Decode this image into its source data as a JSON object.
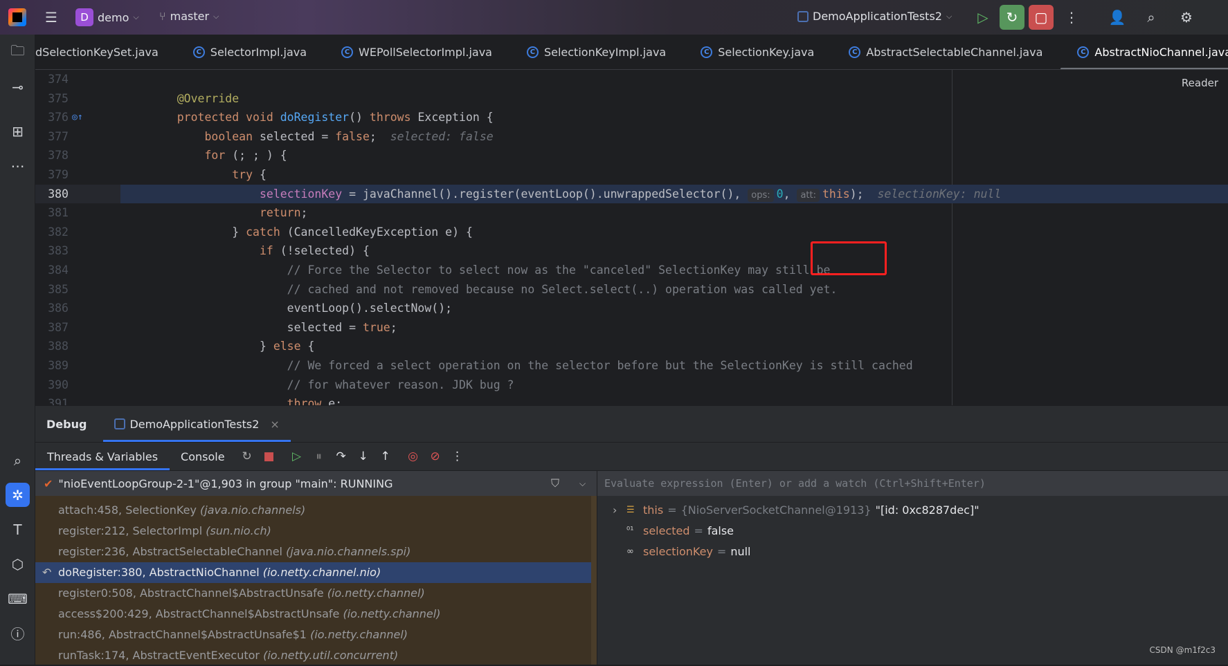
{
  "titlebar": {
    "project_initial": "D",
    "project": "demo",
    "branch": "master",
    "run_config": "DemoApplicationTests2"
  },
  "tabs": [
    {
      "label": "dSelectionKeySet.java",
      "icon": false
    },
    {
      "label": "SelectorImpl.java",
      "icon": true
    },
    {
      "label": "WEPollSelectorImpl.java",
      "icon": true
    },
    {
      "label": "SelectionKeyImpl.java",
      "icon": true
    },
    {
      "label": "SelectionKey.java",
      "icon": true
    },
    {
      "label": "AbstractSelectableChannel.java",
      "icon": true
    },
    {
      "label": "AbstractNioChannel.java",
      "icon": true,
      "active": true,
      "close": "×"
    }
  ],
  "editor": {
    "reader_label": "Reader",
    "current_line": 380,
    "lines": [
      {
        "n": "374",
        "t": []
      },
      {
        "n": "375",
        "t": [
          [
            "    @Override",
            "an"
          ]
        ]
      },
      {
        "n": "376",
        "t": [
          [
            "    protected void ",
            "kw"
          ],
          [
            "doRegister",
            "fn"
          ],
          [
            "() ",
            "tx"
          ],
          [
            "throws ",
            "kw"
          ],
          [
            "Exception {",
            "tx"
          ]
        ],
        "marker": true
      },
      {
        "n": "377",
        "t": [
          [
            "        boolean ",
            "kw"
          ],
          [
            "selected = ",
            "tx"
          ],
          [
            "false",
            "kw"
          ],
          [
            ";",
            "tx"
          ],
          [
            "  selected: false",
            "hint"
          ]
        ]
      },
      {
        "n": "378",
        "t": [
          [
            "        for ",
            "kw"
          ],
          [
            "(; ; ) {",
            "tx"
          ]
        ]
      },
      {
        "n": "379",
        "t": [
          [
            "            try ",
            "kw"
          ],
          [
            "{",
            "tx"
          ]
        ]
      },
      {
        "n": "380",
        "t": [
          [
            "                ",
            "tx"
          ],
          [
            "selectionKey",
            "fd"
          ],
          [
            " = javaChannel().register(eventLoop().unwrappedSelector(), ",
            "tx"
          ],
          [
            "ops:",
            "param"
          ],
          [
            "0",
            "nm"
          ],
          [
            ", ",
            "tx"
          ],
          [
            "att:",
            "param"
          ],
          [
            "this",
            "kw"
          ],
          [
            ");",
            "tx"
          ],
          [
            "  selectionKey: null",
            "hint"
          ]
        ]
      },
      {
        "n": "381",
        "t": [
          [
            "                return",
            "kw"
          ],
          [
            ";",
            "tx"
          ]
        ]
      },
      {
        "n": "382",
        "t": [
          [
            "            } ",
            "tx"
          ],
          [
            "catch ",
            "kw"
          ],
          [
            "(CancelledKeyException e) {",
            "tx"
          ]
        ]
      },
      {
        "n": "383",
        "t": [
          [
            "                if ",
            "kw"
          ],
          [
            "(!selected) {",
            "tx"
          ]
        ]
      },
      {
        "n": "384",
        "t": [
          [
            "                    // Force the Selector to select now as the \"canceled\" SelectionKey may still be",
            "cm"
          ]
        ]
      },
      {
        "n": "385",
        "t": [
          [
            "                    // cached and not removed because no Select.select(..) operation was called yet.",
            "cm"
          ]
        ]
      },
      {
        "n": "386",
        "t": [
          [
            "                    eventLoop().selectNow();",
            "tx"
          ]
        ]
      },
      {
        "n": "387",
        "t": [
          [
            "                    selected = ",
            "tx"
          ],
          [
            "true",
            "kw"
          ],
          [
            ";",
            "tx"
          ]
        ]
      },
      {
        "n": "388",
        "t": [
          [
            "                } ",
            "tx"
          ],
          [
            "else ",
            "kw"
          ],
          [
            "{",
            "tx"
          ]
        ]
      },
      {
        "n": "389",
        "t": [
          [
            "                    // We forced a select operation on the selector before but the SelectionKey is still cached",
            "cm"
          ]
        ]
      },
      {
        "n": "390",
        "t": [
          [
            "                    // for whatever reason. JDK bug ?",
            "cm"
          ]
        ]
      },
      {
        "n": "391",
        "t": [
          [
            "                    throw ",
            "kw"
          ],
          [
            "e;",
            "tx"
          ]
        ]
      }
    ]
  },
  "debug": {
    "title": "Debug",
    "session": "DemoApplicationTests2",
    "session_close": "×",
    "subtabs": [
      "Threads & Variables",
      "Console"
    ],
    "thread": "\"nioEventLoopGroup-2-1\"@1,903 in group \"main\": RUNNING",
    "frames": [
      {
        "m": "attach:458, SelectionKey ",
        "p": "(java.nio.channels)"
      },
      {
        "m": "register:212, SelectorImpl ",
        "p": "(sun.nio.ch)"
      },
      {
        "m": "register:236, AbstractSelectableChannel ",
        "p": "(java.nio.channels.spi)"
      },
      {
        "m": "doRegister:380, AbstractNioChannel ",
        "p": "(io.netty.channel.nio)",
        "selected": true
      },
      {
        "m": "register0:508, AbstractChannel$AbstractUnsafe ",
        "p": "(io.netty.channel)"
      },
      {
        "m": "access$200:429, AbstractChannel$AbstractUnsafe ",
        "p": "(io.netty.channel)"
      },
      {
        "m": "run:486, AbstractChannel$AbstractUnsafe$1 ",
        "p": "(io.netty.channel)"
      },
      {
        "m": "runTask:174, AbstractEventExecutor ",
        "p": "(io.netty.util.concurrent)"
      }
    ],
    "eval_placeholder": "Evaluate expression (Enter) or add a watch (Ctrl+Shift+Enter)",
    "variables": [
      {
        "name": "this",
        "type": "{NioServerSocketChannel@1913}",
        "value": "\"[id: 0xc8287dec]\"",
        "icon": "object-icon",
        "expandable": true
      },
      {
        "name": "selected",
        "type": "",
        "value": "false",
        "icon": "primitive-icon"
      },
      {
        "name": "selectionKey",
        "type": "",
        "value": "null",
        "icon": "watch-icon"
      }
    ],
    "equals": "="
  },
  "watermark": "CSDN @m1f2c3",
  "colors": {
    "accent": "#3574f0",
    "highlight_box": "#ff2020",
    "frames_bg": "#3d3223",
    "selected_frame": "#2e436e"
  }
}
